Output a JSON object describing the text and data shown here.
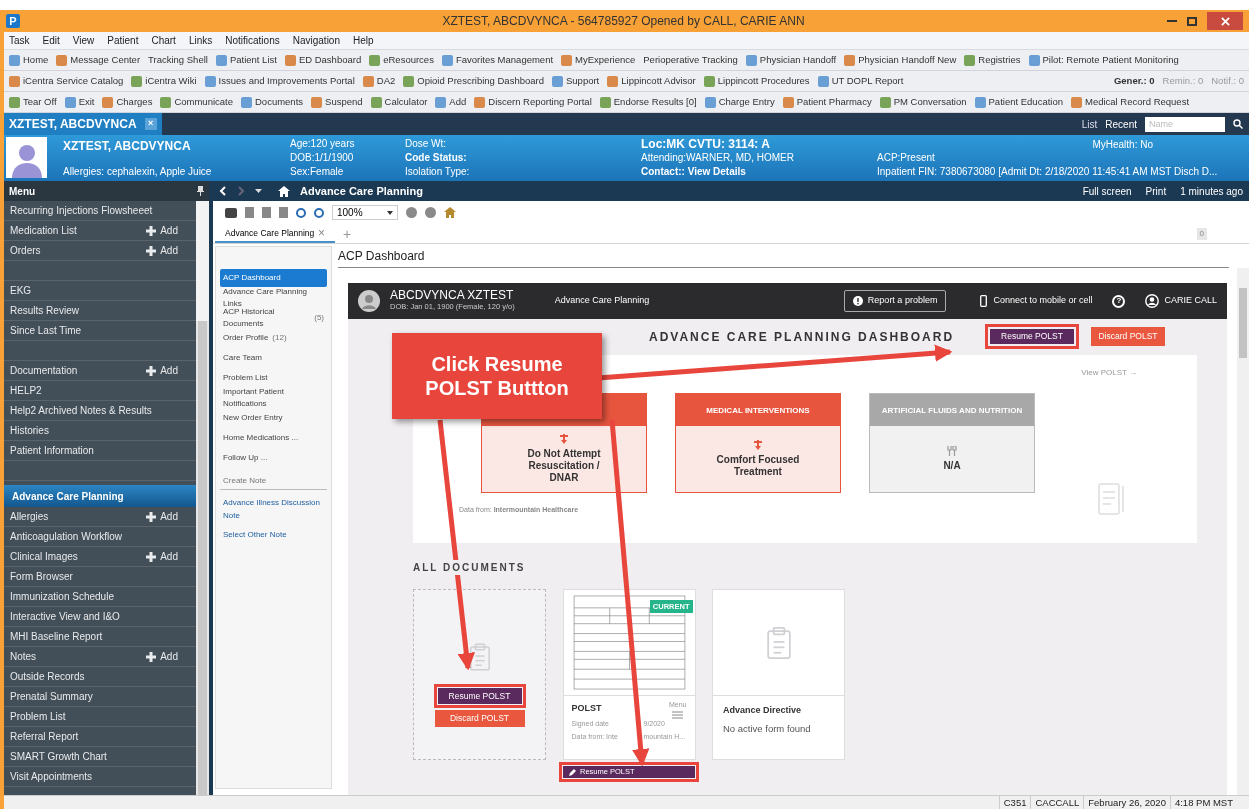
{
  "window": {
    "app_letter": "P",
    "title": "XZTEST, ABCDVYNCA - 564785927 Opened by CALL, CARIE ANN"
  },
  "menu_bar": [
    "Task",
    "Edit",
    "View",
    "Patient",
    "Chart",
    "Links",
    "Notifications",
    "Navigation",
    "Help"
  ],
  "toolbars": [
    [
      {
        "label": "Home",
        "icon": true
      },
      {
        "label": "Message Center",
        "icon": true
      },
      {
        "label": "Tracking Shell",
        "icon": false
      },
      {
        "label": "Patient List",
        "icon": true
      },
      {
        "label": "ED Dashboard",
        "icon": true
      },
      {
        "label": "eResources",
        "icon": true
      },
      {
        "label": "Favorites Management",
        "icon": true
      },
      {
        "label": "MyExperience",
        "icon": true
      },
      {
        "label": "Perioperative Tracking",
        "icon": false
      },
      {
        "label": "Physician Handoff",
        "icon": true
      },
      {
        "label": "Physician Handoff New",
        "icon": true
      },
      {
        "label": "Registries",
        "icon": true
      },
      {
        "label": "Pilot: Remote Patient Monitoring",
        "icon": true
      }
    ],
    [
      {
        "label": "iCentra Service Catalog",
        "icon": true
      },
      {
        "label": "iCentra Wiki",
        "icon": true
      },
      {
        "label": "Issues and Improvements Portal",
        "icon": true
      },
      {
        "label": "DA2",
        "icon": true
      },
      {
        "label": "Opioid Prescribing Dashboard",
        "icon": true
      },
      {
        "label": "Support",
        "icon": true
      },
      {
        "label": "Lippincott Advisor",
        "icon": true
      },
      {
        "label": "Lippincott Procedures",
        "icon": true
      },
      {
        "label": "UT DOPL Report",
        "icon": true
      }
    ],
    [
      {
        "label": "Tear Off",
        "icon": true
      },
      {
        "label": "Exit",
        "icon": true
      },
      {
        "label": "Charges",
        "icon": true
      },
      {
        "label": "Communicate",
        "icon": true
      },
      {
        "label": "Documents",
        "icon": true
      },
      {
        "label": "Suspend",
        "icon": true
      },
      {
        "label": "Calculator",
        "icon": true
      },
      {
        "label": "Add",
        "icon": true
      },
      {
        "label": "Discern Reporting Portal",
        "icon": true
      },
      {
        "label": "Endorse Results [0]",
        "icon": true
      },
      {
        "label": "Charge Entry",
        "icon": true
      },
      {
        "label": "Patient Pharmacy",
        "icon": true
      },
      {
        "label": "PM Conversation",
        "icon": true
      },
      {
        "label": "Patient Education",
        "icon": true
      },
      {
        "label": "Medical Record Request",
        "icon": true
      }
    ]
  ],
  "counters": [
    {
      "label": "Gener.: 0",
      "bold": true
    },
    {
      "label": "Remin.: 0",
      "bold": false
    },
    {
      "label": "Notif.: 0",
      "bold": false
    }
  ],
  "patient_tab": {
    "label": "XZTEST, ABCDVYNCA",
    "close": "×"
  },
  "patient_nav": {
    "list": "List",
    "recent": "Recent",
    "search": {
      "placeholder": "Name"
    }
  },
  "banner": {
    "name": "XZTEST, ABCDVYNCA",
    "allergies": "Allergies: cephalexin, Apple Juice",
    "myhealth": "MyHealth: No",
    "columns": [
      [
        {
          "text": "Age:120 years",
          "bold": false
        },
        {
          "text": "DOB:1/1/1900",
          "bold": false
        },
        {
          "text": "Sex:Female",
          "bold": false
        }
      ],
      [
        {
          "text": "Dose Wt:",
          "bold": false
        },
        {
          "text": "Code Status:",
          "bold": true
        },
        {
          "text": "Isolation Type:",
          "bold": false
        }
      ],
      [
        {
          "text": "Loc:MK  CVTU: 3114: A",
          "bold": true
        },
        {
          "text": "Attending:WARNER, MD, HOMER",
          "bold": false
        },
        {
          "text": "Contact:: View Details",
          "bold": true
        }
      ],
      [
        {
          "text": "ACP:Present",
          "bold": false
        },
        {
          "text": "Inpatient FIN: 7380673080 [Admit Dt: 2/18/2020 11:45:41 AM MST Disch D...",
          "bold": false
        }
      ]
    ]
  },
  "menu": {
    "title": "Menu",
    "items": [
      {
        "kind": "item",
        "label": "Recurring Injections Flowsheeet"
      },
      {
        "kind": "item",
        "label": "Medication List",
        "action": "Add"
      },
      {
        "kind": "item",
        "label": "Orders",
        "action": "Add"
      },
      {
        "kind": "spacer"
      },
      {
        "kind": "item",
        "label": "EKG"
      },
      {
        "kind": "item",
        "label": "Results Review"
      },
      {
        "kind": "item",
        "label": "Since Last Time"
      },
      {
        "kind": "spacer"
      },
      {
        "kind": "item",
        "label": "Documentation",
        "action": "Add"
      },
      {
        "kind": "item",
        "label": "HELP2"
      },
      {
        "kind": "item",
        "label": "Help2 Archived Notes & Results"
      },
      {
        "kind": "item",
        "label": "Histories"
      },
      {
        "kind": "item",
        "label": "Patient Information"
      },
      {
        "kind": "spacer"
      },
      {
        "kind": "section",
        "label": "Advance Care Planning",
        "selected": true
      },
      {
        "kind": "item",
        "label": "Allergies",
        "action": "Add"
      },
      {
        "kind": "item",
        "label": "Anticoagulation Workflow"
      },
      {
        "kind": "item",
        "label": "Clinical Images",
        "action": "Add"
      },
      {
        "kind": "item",
        "label": "Form Browser"
      },
      {
        "kind": "item",
        "label": "Immunization Schedule"
      },
      {
        "kind": "item",
        "label": "Interactive View and I&O"
      },
      {
        "kind": "item",
        "label": "MHI Baseline Report"
      },
      {
        "kind": "item",
        "label": "Notes",
        "action": "Add"
      },
      {
        "kind": "item",
        "label": "Outside Records"
      },
      {
        "kind": "item",
        "label": "Prenatal Summary"
      },
      {
        "kind": "item",
        "label": "Problem List"
      },
      {
        "kind": "item",
        "label": "Referral Report"
      },
      {
        "kind": "item",
        "label": "SMART Growth Chart"
      },
      {
        "kind": "item",
        "label": "Visit Appointments"
      }
    ]
  },
  "page_bar": {
    "title": "Advance Care Planning",
    "actions": [
      "Full screen",
      "Print",
      "1 minutes ago"
    ]
  },
  "zoom": "100%",
  "doc_tab": {
    "label": "Advance Care Planning",
    "close": "×",
    "add": "+",
    "count": "0"
  },
  "nav": {
    "items": [
      {
        "kind": "link",
        "label": "ACP Dashboard",
        "selected": true
      },
      {
        "kind": "link",
        "label": "Advance Care Planning Links",
        "selected": false
      },
      {
        "kind": "link",
        "label": "ACP Historical Documents",
        "count": "(5)",
        "selected": false
      },
      {
        "kind": "link",
        "label": "Order Profile",
        "count": "(12)",
        "selected": false
      },
      {
        "kind": "link",
        "label": "Care Team",
        "selected": false
      },
      {
        "kind": "link",
        "label": "Problem List",
        "selected": false
      },
      {
        "kind": "link",
        "label": "Important Patient Notifications",
        "selected": false
      },
      {
        "kind": "link",
        "label": "New Order Entry",
        "selected": false
      },
      {
        "kind": "link",
        "label": "Home Medications ...",
        "selected": false
      },
      {
        "kind": "link",
        "label": "Follow Up ...",
        "selected": false
      },
      {
        "kind": "heading",
        "label": "Create Note"
      },
      {
        "kind": "note",
        "label": "Advance Illness Discussion Note"
      },
      {
        "kind": "note",
        "label": "Select Other Note"
      }
    ]
  },
  "content_title": "ACP Dashboard",
  "app": {
    "patient": "ABCDVYNCA XZTEST",
    "dob": "DOB: Jan 01, 1900 (Female, 120 y/o)",
    "section": "Advance Care Planning",
    "report": "Report a problem",
    "connect": "Connect to mobile or cell",
    "help": "?",
    "user": "CARIE CALL"
  },
  "dashboard": {
    "title": "ADVANCE CARE PLANNING DASHBOARD",
    "resume": "Resume POLST",
    "discard": "Discard POLST",
    "view": "View POLST →",
    "source": "Data from: **Intermountain Healthcare**",
    "cards": [
      {
        "kind": "set",
        "value": "Do Not Attempt Resuscitation / DNAR"
      },
      {
        "kind": "set",
        "header": "MEDICAL INTERVENTIONS",
        "value": "Comfort Focused Treatment"
      },
      {
        "kind": "none",
        "header": "ARTIFICIAL FLUIDS AND NUTRITION",
        "value": "N/A"
      }
    ]
  },
  "documents": {
    "title": "ALL DOCUMENTS",
    "draft": {
      "resume": "Resume POLST",
      "discard": "Discard POLST"
    },
    "polst": {
      "badge": "CURRENT",
      "name": "POLST",
      "signed": [
        "Signed date",
        "9/2020"
      ],
      "source": [
        "Data from: Inte",
        "mountain H..."
      ],
      "menu": "Menu",
      "resume": "Resume POLST"
    },
    "directive": {
      "name": "Advance Directive",
      "status": "No active form found"
    }
  },
  "callout": {
    "lines": [
      "Click Resume",
      "POLST Buttton"
    ]
  },
  "status_bar": [
    "C351",
    "CACCALL",
    "February 26, 2020",
    "4:18 PM MST"
  ]
}
